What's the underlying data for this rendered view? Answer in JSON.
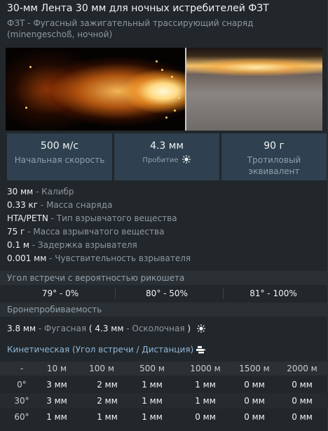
{
  "header": {
    "title": "30-мм Лента 30 мм для ночных истребителей ФЗТ",
    "subtitle": "ФЗТ - Фугасный зажигательный трассирующий снаряд (minengeschoß, ночной)"
  },
  "stats": [
    {
      "value": "500 м/с",
      "label": "Начальная скорость"
    },
    {
      "value": "4.3 мм",
      "label": "Пробитие"
    },
    {
      "value": "90 г",
      "label": "Тротиловый эквивалент"
    }
  ],
  "properties": [
    {
      "value": "30 мм",
      "label": "Калибр"
    },
    {
      "value": "0.33 кг",
      "label": "Масса снаряда"
    },
    {
      "value": "HTA/PETN",
      "label": "Тип взрывчатого вещества"
    },
    {
      "value": "75 г",
      "label": "Масса взрывчатого вещества"
    },
    {
      "value": "0.1 м",
      "label": "Задержка взрывателя"
    },
    {
      "value": "0.001 мм",
      "label": "Чувствительность взрывателя"
    }
  ],
  "ricochet": {
    "title": "Угол встречи с вероятностью рикошета",
    "items": [
      "79° - 0%",
      "80° - 50%",
      "81° - 100%"
    ]
  },
  "penetration": {
    "title": "Бронепробиваемость",
    "he_value": "3.8 мм",
    "he_label": "Фугасная",
    "frag_value": "4.3 мм",
    "frag_label": "Осколочная"
  },
  "kinetic": {
    "title": "Кинетическая (Угол встречи / Дистанция)",
    "columns": [
      "-",
      "10 м",
      "100 м",
      "500 м",
      "1000 м",
      "1500 м",
      "2000 м"
    ],
    "rows": [
      {
        "angle": "0°",
        "values": [
          "3 мм",
          "2 мм",
          "1 мм",
          "1 мм",
          "0 мм",
          "0 мм"
        ]
      },
      {
        "angle": "30°",
        "values": [
          "3 мм",
          "2 мм",
          "1 мм",
          "1 мм",
          "0 мм",
          "0 мм"
        ]
      },
      {
        "angle": "60°",
        "values": [
          "1 мм",
          "1 мм",
          "1 мм",
          "0 мм",
          "0 мм",
          "0 мм"
        ]
      }
    ]
  },
  "icons": {
    "penetration": "explosion-icon",
    "kinetic": "shell-distance-icon"
  },
  "colors": {
    "stat_box": "#2f4150",
    "kinetic_title": "#8fb6d8"
  }
}
